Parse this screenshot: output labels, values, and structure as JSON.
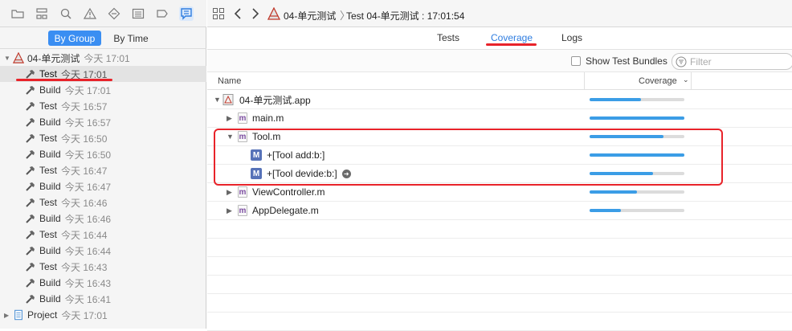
{
  "sidebar": {
    "nav_icons": [
      "folder-icon",
      "hierarchy-icon",
      "search-icon",
      "warning-icon",
      "diamond-icon",
      "list-icon",
      "tag-icon",
      "report-icon"
    ],
    "group_by": {
      "by_group": "By Group",
      "by_time": "By Time"
    },
    "root": {
      "label": "04-单元测试",
      "time": "今天 17:01"
    },
    "items": [
      {
        "label": "Test",
        "time": "今天 17:01",
        "selected": true
      },
      {
        "label": "Build",
        "time": "今天 17:01"
      },
      {
        "label": "Test",
        "time": "今天 16:57"
      },
      {
        "label": "Build",
        "time": "今天 16:57"
      },
      {
        "label": "Test",
        "time": "今天 16:50"
      },
      {
        "label": "Build",
        "time": "今天 16:50"
      },
      {
        "label": "Test",
        "time": "今天 16:47"
      },
      {
        "label": "Build",
        "time": "今天 16:47"
      },
      {
        "label": "Test",
        "time": "今天 16:46"
      },
      {
        "label": "Build",
        "time": "今天 16:46"
      },
      {
        "label": "Test",
        "time": "今天 16:44"
      },
      {
        "label": "Build",
        "time": "今天 16:44"
      },
      {
        "label": "Test",
        "time": "今天 16:43"
      },
      {
        "label": "Build",
        "time": "今天 16:43"
      },
      {
        "label": "Build",
        "time": "今天 16:41"
      }
    ],
    "project": {
      "label": "Project",
      "time": "今天 17:01"
    }
  },
  "breadcrumb": {
    "project": "04-单元测试",
    "current": "Test 04-单元测试 : 17:01:54"
  },
  "tabs": {
    "tests": "Tests",
    "coverage": "Coverage",
    "logs": "Logs",
    "active": "Coverage"
  },
  "filter": {
    "show_bundles": "Show Test Bundles",
    "placeholder": "Filter"
  },
  "columns": {
    "name": "Name",
    "coverage": "Coverage"
  },
  "coverage_rows": [
    {
      "name": "04-单元测试.app",
      "kind": "app",
      "coverage": 0.54
    },
    {
      "name": "main.m",
      "kind": "file",
      "coverage": 1.0
    },
    {
      "name": "Tool.m",
      "kind": "file",
      "coverage": 0.78
    },
    {
      "name": "+[Tool add:b:]",
      "kind": "method",
      "coverage": 1.0
    },
    {
      "name": "+[Tool devide:b:]",
      "kind": "method",
      "coverage": 0.67
    },
    {
      "name": "ViewController.m",
      "kind": "file",
      "coverage": 0.5
    },
    {
      "name": "AppDelegate.m",
      "kind": "file",
      "coverage": 0.33
    }
  ],
  "colors": {
    "accent": "#3a8ef2",
    "bar": "#3b9de6",
    "annotation": "#e8232a"
  }
}
